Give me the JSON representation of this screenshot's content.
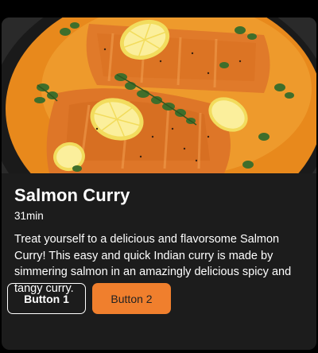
{
  "card": {
    "image_alt": "Salmon Curry",
    "title": "Salmon Curry",
    "time": "31min",
    "description": "Treat yourself to a delicious and flavorsome Salmon Curry! This easy and quick Indian curry is made by simmering salmon in an amazingly delicious spicy and tangy curry.",
    "buttons": {
      "primary_label": "Button 1",
      "secondary_label": "Button 2"
    }
  },
  "colors": {
    "page_background": "#000000",
    "card_background": "#1c1c1c",
    "accent": "#f07f2d",
    "text": "#ffffff"
  }
}
